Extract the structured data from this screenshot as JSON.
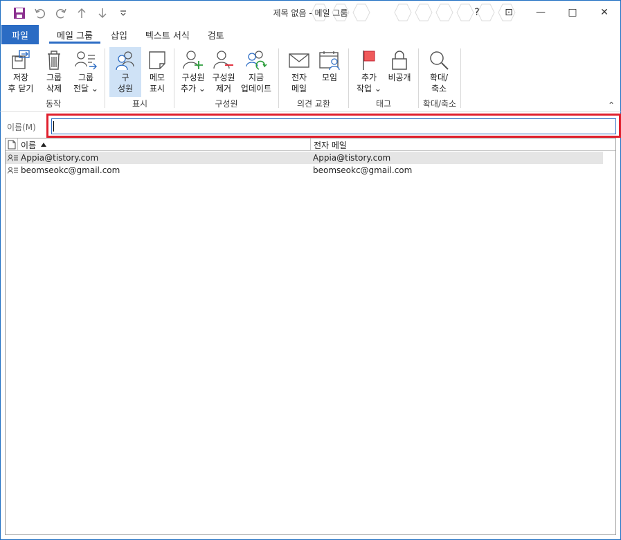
{
  "window": {
    "title": "제목 없음  -  메일 그룹",
    "help": "?",
    "ribbon_display": "⊡",
    "minimize": "—",
    "maximize": "□",
    "close": "✕"
  },
  "tabs": {
    "file": "파일",
    "items": [
      "메일 그룹",
      "삽입",
      "텍스트 서식",
      "검토"
    ]
  },
  "ribbon": {
    "groups": {
      "actions": "동작",
      "show": "표시",
      "members": "구성원",
      "communicate": "의견 교환",
      "tags": "태그",
      "zoom": "확대/축소"
    },
    "buttons": {
      "save_close": [
        "저장",
        "후 닫기"
      ],
      "delete_group": [
        "그룹",
        "삭제"
      ],
      "forward_group": [
        "그룹",
        "전달 ⌄"
      ],
      "members": [
        "구",
        "성원"
      ],
      "notes": [
        "메모",
        "표시"
      ],
      "add_members": [
        "구성원",
        "추가 ⌄"
      ],
      "remove_member": [
        "구성원",
        "제거"
      ],
      "update_now": [
        "지금",
        "업데이트"
      ],
      "email": [
        "전자",
        "메일"
      ],
      "meeting": [
        "모임"
      ],
      "follow_up": [
        "추가",
        "작업 ⌄"
      ],
      "private": [
        "비공개"
      ],
      "zoom": [
        "확대/",
        "축소"
      ]
    },
    "collapse": "⌃"
  },
  "name_field": {
    "label": "이름(M)",
    "value": ""
  },
  "member_list": {
    "headers": {
      "name": "이름",
      "email": "전자 메일"
    },
    "rows": [
      {
        "name": "Appia@tistory.com",
        "email": "Appia@tistory.com"
      },
      {
        "name": "beomseokc@gmail.com",
        "email": "beomseokc@gmail.com"
      }
    ]
  },
  "colors": {
    "accent": "#2b6cc4",
    "highlight": "#e01f2d",
    "save_icon": "#8b2f8f",
    "flag": "#e01f2d",
    "add_green": "#2e9e3e"
  }
}
